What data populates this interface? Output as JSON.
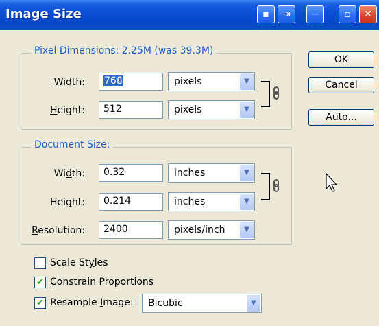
{
  "window": {
    "title": "Image Size"
  },
  "pixel_dimensions": {
    "legend": "Pixel Dimensions:  2.25M (was 39.3M)",
    "width": {
      "label_pre": "",
      "label_u": "W",
      "label_post": "idth:",
      "value": "768",
      "unit": "pixels"
    },
    "height": {
      "label_pre": "",
      "label_u": "H",
      "label_post": "eight:",
      "value": "512",
      "unit": "pixels"
    }
  },
  "document_size": {
    "legend": "Document Size:",
    "width": {
      "label_pre": "Wi",
      "label_u": "d",
      "label_post": "th:",
      "value": "0.32",
      "unit": "inches"
    },
    "height": {
      "label_pre": "Hei",
      "label_u": "g",
      "label_post": "ht:",
      "value": "0.214",
      "unit": "inches"
    },
    "resolution": {
      "label_pre": "",
      "label_u": "R",
      "label_post": "esolution:",
      "value": "2400",
      "unit": "pixels/inch"
    }
  },
  "buttons": {
    "ok": "OK",
    "cancel": "Cancel",
    "auto": "Auto..."
  },
  "options": {
    "scale_styles": {
      "pre": "Scale St",
      "u": "y",
      "post": "les",
      "checked": false
    },
    "constrain": {
      "pre": "",
      "u": "C",
      "post": "onstrain Proportions",
      "checked": true
    },
    "resample": {
      "pre": "Resample ",
      "u": "I",
      "post": "mage:",
      "checked": true,
      "method": "Bicubic"
    }
  },
  "colors": {
    "titlebar": "#0a4fd6",
    "legend_text": "#1f5fc8",
    "checkmark": "#21a121",
    "dialog_bg": "#ece9d8"
  },
  "icons": [
    "dialog-icon",
    "pin-icon",
    "minimize-icon",
    "restore-icon",
    "close-icon",
    "link-chain-icon",
    "arrow-cursor-icon",
    "chevron-down-icon",
    "checkmark-icon"
  ]
}
